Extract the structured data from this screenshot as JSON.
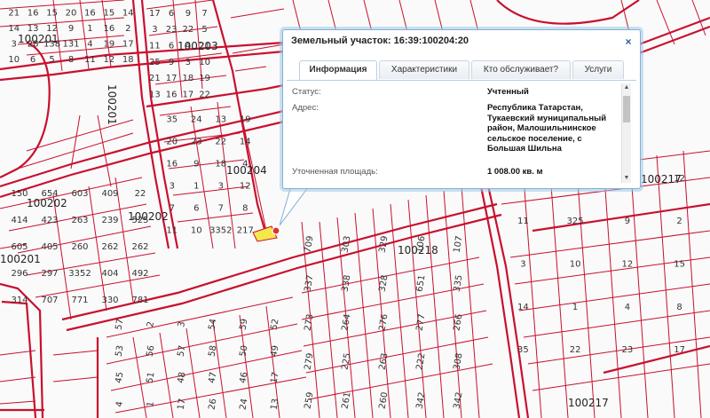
{
  "popup": {
    "title": "Земельный участок: 16:39:100204:20",
    "close_glyph": "×",
    "tabs": [
      {
        "label": "Информация",
        "active": true
      },
      {
        "label": "Характеристики",
        "active": false
      },
      {
        "label": "Кто обслуживает?",
        "active": false
      },
      {
        "label": "Услуги",
        "active": false
      }
    ],
    "fields": [
      {
        "label": "Статус:",
        "value": "Учтенный"
      },
      {
        "label": "Адрес:",
        "value": "Республика Татарстан, Тукаевский муниципальный район, Малошильнинское сельское поселение, с Большая Шильна"
      },
      {
        "label": "Уточненная площадь:",
        "value": "1 008.00 кв. м"
      }
    ]
  },
  "map": {
    "line_color": "#c8102e",
    "selected_fill": "#f5e84a",
    "quarters": [
      "100201",
      "100203",
      "100201",
      "100204",
      "100202",
      "100202",
      "100218",
      "100201",
      "100217",
      "100217"
    ],
    "parcels": [
      "21",
      "16",
      "15",
      "20",
      "16",
      "15",
      "14",
      "14",
      "13",
      "12",
      "9",
      "1",
      "16",
      "2",
      "3",
      "28",
      "138",
      "131",
      "4",
      "19",
      "17",
      "10",
      "6",
      "5",
      "8",
      "11",
      "12",
      "18",
      "17",
      "6",
      "9",
      "7",
      "3",
      "23",
      "22",
      "5",
      "11",
      "6",
      "4",
      "21",
      "25",
      "9",
      "3",
      "10",
      "21",
      "17",
      "18",
      "19",
      "13",
      "16",
      "17",
      "22",
      "35",
      "24",
      "13",
      "19",
      "20",
      "23",
      "22",
      "14",
      "16",
      "9",
      "18",
      "4",
      "3",
      "1",
      "3",
      "12",
      "7",
      "6",
      "7",
      "8",
      "11",
      "10",
      "3352",
      "217",
      "150",
      "654",
      "603",
      "409",
      "22",
      "414",
      "423",
      "263",
      "239",
      "525",
      "605",
      "405",
      "260",
      "262",
      "262",
      "296",
      "297",
      "3352",
      "404",
      "492",
      "314",
      "707",
      "771",
      "330",
      "781",
      "709",
      "303",
      "329",
      "106",
      "107",
      "337",
      "338",
      "328",
      "651",
      "335",
      "273",
      "264",
      "276",
      "277",
      "266",
      "279",
      "225",
      "263",
      "222",
      "308",
      "259",
      "261",
      "260",
      "342",
      "342",
      "57",
      "2",
      "3",
      "54",
      "59",
      "52",
      "53",
      "56",
      "57",
      "58",
      "50",
      "49",
      "45",
      "51",
      "48",
      "47",
      "46",
      "17",
      "4",
      "1",
      "17",
      "26",
      "24",
      "13",
      "14",
      "15",
      "16",
      "12",
      "11",
      "325",
      "9",
      "2",
      "3",
      "10",
      "12",
      "15",
      "14",
      "1",
      "4",
      "8",
      "35",
      "22",
      "23",
      "17"
    ]
  }
}
